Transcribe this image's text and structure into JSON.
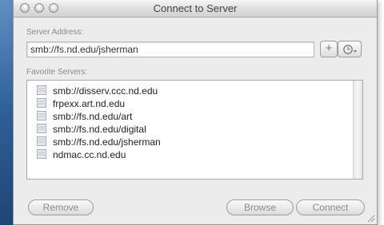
{
  "window": {
    "title": "Connect to Server"
  },
  "server_address": {
    "label": "Server Address:",
    "value": "smb://fs.nd.edu/jsherman",
    "add_button": "+"
  },
  "favorites": {
    "label": "Favorite Servers:",
    "items": [
      "smb://disserv.ccc.nd.edu",
      "frpexx.art.nd.edu",
      "smb://fs.nd.edu/art",
      "smb://fs.nd.edu/digital",
      "smb://fs.nd.edu/jsherman",
      "ndmac.cc.nd.edu"
    ]
  },
  "buttons": {
    "remove": "Remove",
    "browse": "Browse",
    "connect": "Connect"
  },
  "icons": {
    "favorite_server": "server-icon",
    "recent": "clock-icon"
  }
}
